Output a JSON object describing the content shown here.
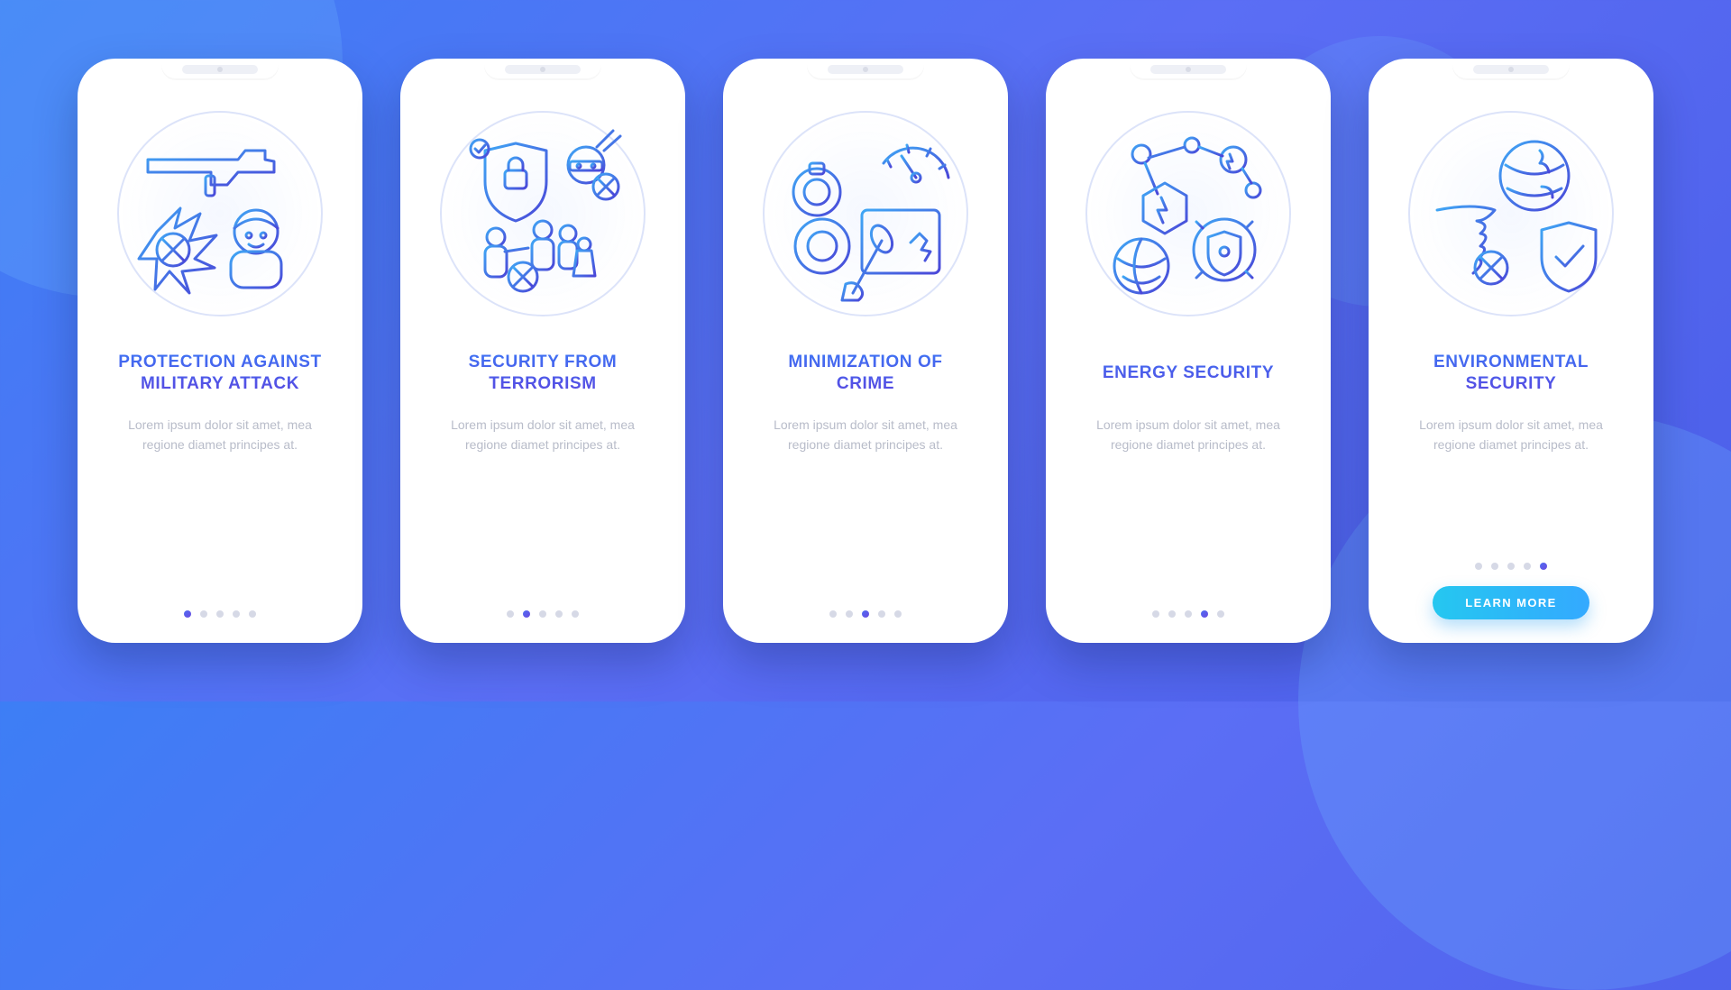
{
  "colors": {
    "accent_gradient_start": "#3d74f5",
    "accent_gradient_end": "#5a46e0",
    "cta_gradient_start": "#25c7f0",
    "cta_gradient_end": "#34a9ff",
    "body_text": "#b8bcc9",
    "dot_inactive": "#d6d9e6"
  },
  "screens": [
    {
      "icon": "military-attack-illustration",
      "title": "PROTECTION AGAINST MILITARY ATTACK",
      "body": "Lorem ipsum dolor sit amet, mea regione diamet principes at.",
      "active_dot": 0,
      "show_cta": false
    },
    {
      "icon": "terrorism-illustration",
      "title": "SECURITY FROM TERRORISM",
      "body": "Lorem ipsum dolor sit amet, mea regione diamet principes at.",
      "active_dot": 1,
      "show_cta": false
    },
    {
      "icon": "crime-illustration",
      "title": "MINIMIZATION OF CRIME",
      "body": "Lorem ipsum dolor sit amet, mea regione diamet principes at.",
      "active_dot": 2,
      "show_cta": false
    },
    {
      "icon": "energy-illustration",
      "title": "ENERGY SECURITY",
      "body": "Lorem ipsum dolor sit amet, mea regione diamet principes at.",
      "active_dot": 3,
      "show_cta": false
    },
    {
      "icon": "environmental-illustration",
      "title": "ENVIRONMENTAL SECURITY",
      "body": "Lorem ipsum dolor sit amet, mea regione diamet principes at.",
      "active_dot": 4,
      "show_cta": true
    }
  ],
  "cta_label": "LEARN MORE",
  "dot_count": 5
}
